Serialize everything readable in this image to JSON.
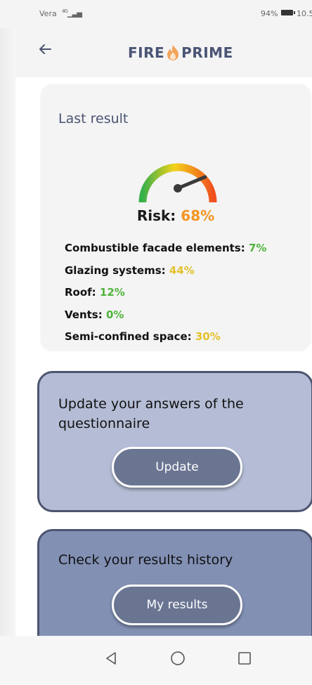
{
  "status_bar": {
    "carrier": "Vera",
    "network": "4G",
    "battery_percent": "94%",
    "time": "10.5"
  },
  "app_bar": {
    "brand_left": "FIRE",
    "brand_right": "PRIME"
  },
  "result_card": {
    "title": "Last result",
    "risk_label": "Risk:",
    "risk_value": "68%",
    "gauge_fraction": 0.68,
    "factors": [
      {
        "label": "Combustible facade elements:",
        "value": "7%",
        "color": "#4fb43b"
      },
      {
        "label": "Glazing systems:",
        "value": "44%",
        "color": "#e4c12a"
      },
      {
        "label": "Roof:",
        "value": "12%",
        "color": "#4fb43b"
      },
      {
        "label": "Vents:",
        "value": "0%",
        "color": "#4fb43b"
      },
      {
        "label": "Semi-confined space:",
        "value": "30%",
        "color": "#e4c12a"
      }
    ]
  },
  "update_card": {
    "text": "Update your answers of the questionnaire",
    "button_label": "Update"
  },
  "history_card": {
    "text": "Check your results history",
    "button_label": "My results"
  },
  "icons": {
    "back": "arrow-left-icon",
    "nav_back": "triangle-back-icon",
    "nav_home": "circle-home-icon",
    "nav_recent": "square-recent-icon"
  },
  "colors": {
    "accent": "#4b5371",
    "risk": "#f29520",
    "low": "#4fb43b",
    "medium": "#e4c12a",
    "update_card": "#b4bdd5",
    "history_card": "#8290b4",
    "button": "#6a7592"
  }
}
